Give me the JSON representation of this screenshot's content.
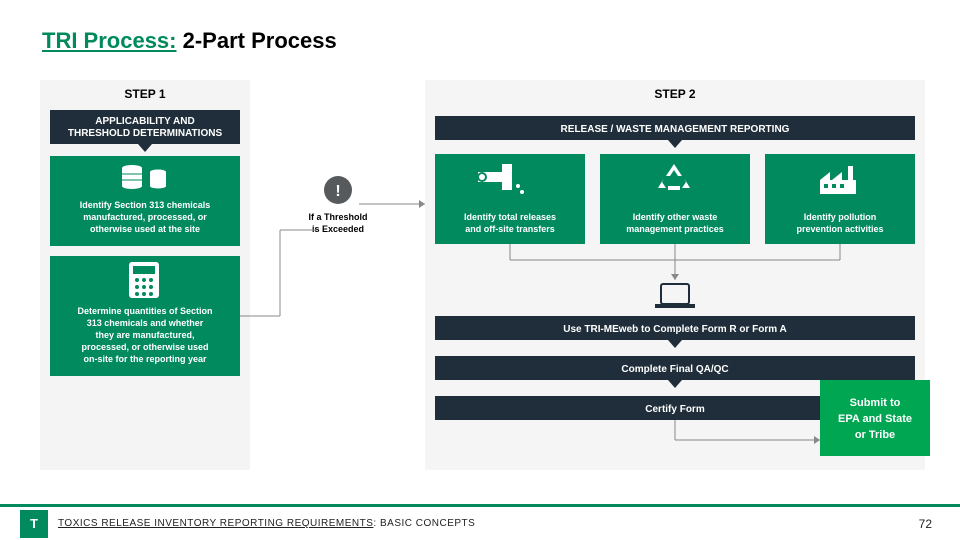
{
  "title": {
    "prefix": "TRI Process:",
    "suffix": " 2-Part Process"
  },
  "steps": {
    "one": "STEP 1",
    "two": "STEP 2"
  },
  "banners": {
    "left_l1": "APPLICABILITY AND",
    "left_l2": "THRESHOLD DETERMINATIONS",
    "right": "RELEASE / WASTE MANAGEMENT REPORTING"
  },
  "boxes": {
    "s1a_l1": "Identify Section 313 chemicals",
    "s1a_l2": "manufactured, processed, or",
    "s1a_l3": "otherwise used at the site",
    "s1b_l1": "Determine quantities of Section",
    "s1b_l2": "313 chemicals and whether",
    "s1b_l3": "they are manufactured,",
    "s1b_l4": "processed, or otherwise used",
    "s1b_l5": "on-site for the reporting year",
    "s2a_l1": "Identify total releases",
    "s2a_l2": "and off-site transfers",
    "s2b_l1": "Identify other waste",
    "s2b_l2": "management practices",
    "s2c_l1": "Identify pollution",
    "s2c_l2": "prevention activities"
  },
  "bars": {
    "form": "Use TRI-MEweb to Complete Form R or Form A",
    "qa": "Complete Final QA/QC",
    "certify": "Certify Form"
  },
  "note": {
    "l1": "If a Threshold",
    "l2": "is Exceeded"
  },
  "submit": {
    "l1": "Submit to",
    "l2": "EPA and State",
    "l3": "or Tribe"
  },
  "footer": {
    "logo": "T",
    "text_a": "TOXICS RELEASE INVENTORY REPORTING REQUIREMENTS",
    "text_b": ": BASIC CONCEPTS",
    "page": "72"
  },
  "colors": {
    "teal": "#008a5e",
    "dark": "#1f2e3a",
    "green": "#00a651"
  }
}
